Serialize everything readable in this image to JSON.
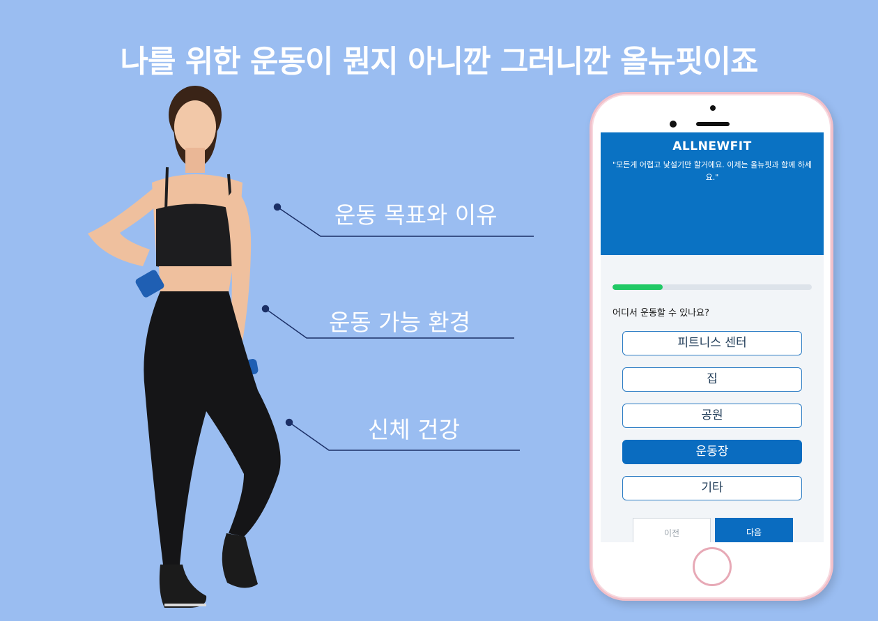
{
  "headline": "나를 위한 운동이 뭔지 아니깐 그러니깐 올뉴핏이죠",
  "callouts": [
    {
      "label": "운동 목표와 이유"
    },
    {
      "label": "운동 가능 환경"
    },
    {
      "label": "신체 건강"
    }
  ],
  "app": {
    "brand": "ALLNEWFIT",
    "quote": "\"모든게 어렵고 낯설기만 할거에요. 이제는 올뉴핏과 함께 하세요.\"",
    "progress_fraction": 0.25,
    "question": "어디서 운동할 수 있나요?",
    "options": [
      {
        "label": "피트니스 센터",
        "selected": false
      },
      {
        "label": "집",
        "selected": false
      },
      {
        "label": "공원",
        "selected": false
      },
      {
        "label": "운동장",
        "selected": true
      },
      {
        "label": "기타",
        "selected": false
      }
    ],
    "prev_label": "이전",
    "next_label": "다음"
  },
  "colors": {
    "background": "#9abdf1",
    "header_blue": "#0a72c3",
    "button_blue": "#0a6cc0",
    "progress_green": "#21c965",
    "phone_frame": "#f1bfc9"
  }
}
